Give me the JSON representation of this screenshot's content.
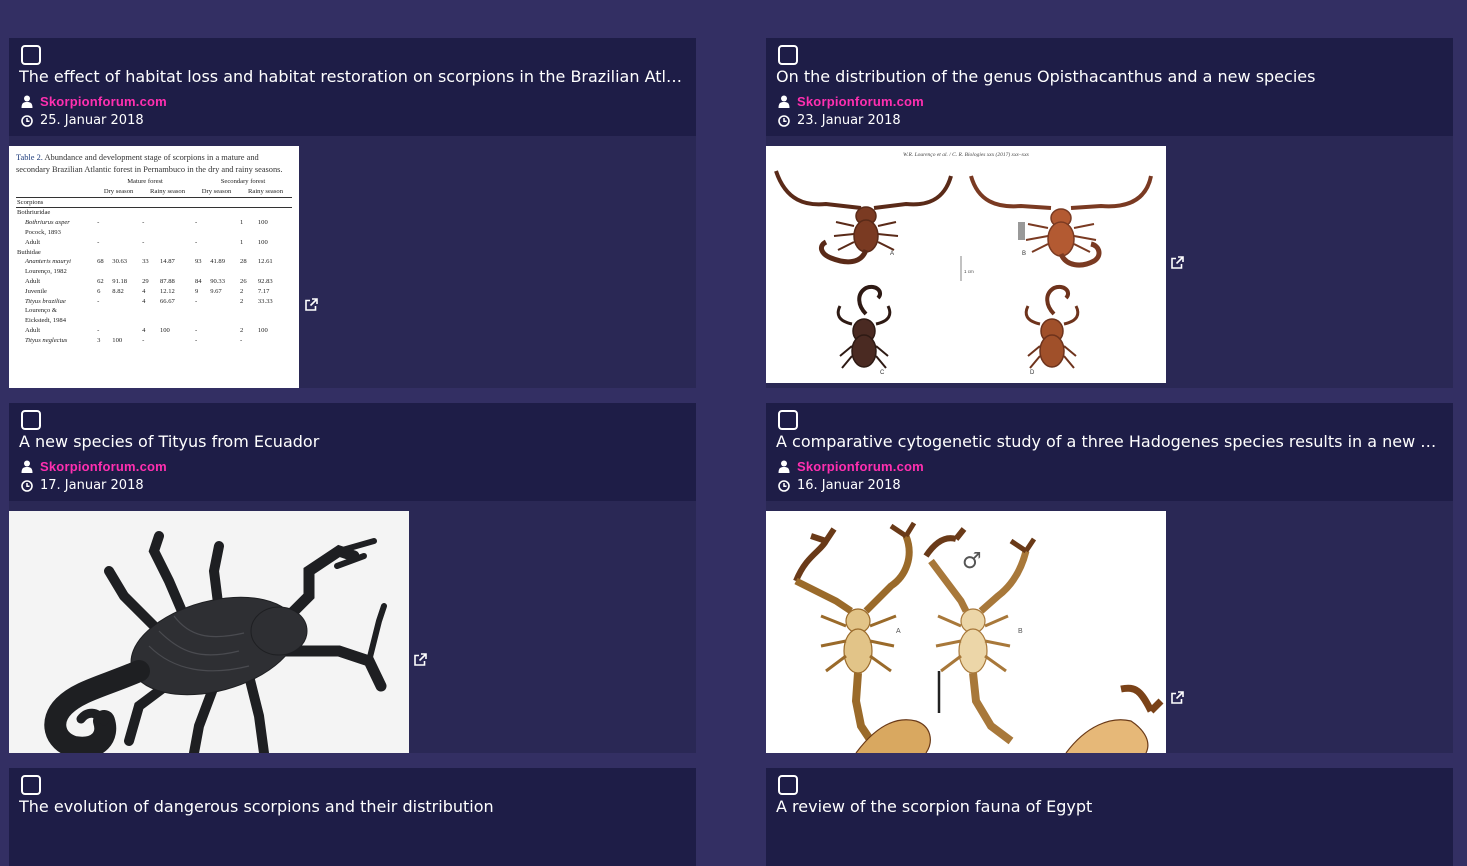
{
  "posts": [
    {
      "title": "The effect of habitat loss and habitat restoration on scorpions in the Brazilian Atl…",
      "author": "Skorpionforum.com",
      "date": "25. Januar 2018",
      "thumb": "table-figure"
    },
    {
      "title": "On the distribution of the genus Opisthacanthus and a new species",
      "author": "Skorpionforum.com",
      "date": "23. Januar 2018",
      "thumb": "scorpion-plate-figure",
      "thumb_header": "W.R. Lourenço et al. / C. R. Biologies xxx (2017) xxx–xxx"
    },
    {
      "title": "A new species of Tityus from Ecuador",
      "author": "Skorpionforum.com",
      "date": "17. Januar 2018",
      "thumb": "black-scorpion-photo"
    },
    {
      "title": "A comparative cytogenetic study of a three Hadogenes species results in a new s…",
      "author": "Skorpionforum.com",
      "date": "16. Januar 2018",
      "thumb": "hadogenes-plate-figure"
    },
    {
      "title": "The evolution of dangerous scorpions and their distribution",
      "author": "",
      "date": ""
    },
    {
      "title": "A review of the scorpion fauna of Egypt",
      "author": "",
      "date": ""
    }
  ],
  "table_figure": {
    "caption_label": "Table 2.",
    "caption": "Abundance and development stage of scorpions in a mature and secondary Brazilian Atlantic forest in Pernambuco in the dry and rainy seasons.",
    "group_headers": [
      "Mature forest",
      "Secondary forest"
    ],
    "season_headers": [
      "Dry season",
      "Rainy season",
      "Dry season",
      "Rainy season"
    ],
    "col_label": "Scorpions",
    "rows": [
      [
        "Bothriuridae",
        "",
        "",
        "",
        "",
        "",
        "",
        "",
        ""
      ],
      [
        "Bothriurus asper",
        "-",
        "",
        "-",
        "",
        "-",
        "",
        "1",
        "100"
      ],
      [
        "Pocock, 1893",
        "",
        "",
        "",
        "",
        "",
        "",
        "",
        ""
      ],
      [
        "Adult",
        "-",
        "",
        "-",
        "",
        "-",
        "",
        "1",
        "100"
      ],
      [
        "Buthidae",
        "",
        "",
        "",
        "",
        "",
        "",
        "",
        ""
      ],
      [
        "Ananteris mauryi",
        "68",
        "30.63",
        "33",
        "14.87",
        "93",
        "41.89",
        "28",
        "12.61"
      ],
      [
        "Lourenço, 1982",
        "",
        "",
        "",
        "",
        "",
        "",
        "",
        ""
      ],
      [
        "Adult",
        "62",
        "91.18",
        "29",
        "87.88",
        "84",
        "90.33",
        "26",
        "92.83"
      ],
      [
        "Juvenile",
        "6",
        "8.82",
        "4",
        "12.12",
        "9",
        "9.67",
        "2",
        "7.17"
      ],
      [
        "Tityus braziliae",
        "-",
        "",
        "4",
        "66.67",
        "-",
        "",
        "2",
        "33.33"
      ],
      [
        "Lourenço &",
        "",
        "",
        "",
        "",
        "",
        "",
        "",
        ""
      ],
      [
        "Eickstedt, 1984",
        "",
        "",
        "",
        "",
        "",
        "",
        "",
        ""
      ],
      [
        "Adult",
        "-",
        "",
        "4",
        "100",
        "-",
        "",
        "2",
        "100"
      ],
      [
        "Tityus neglectus",
        "3",
        "100",
        "-",
        "",
        "-",
        "",
        "-",
        ""
      ]
    ],
    "italic_rows": [
      1,
      5,
      9,
      13
    ]
  },
  "plate_labels": {
    "opisthacanthus": [
      "A",
      "B",
      "C",
      "D"
    ],
    "scale": "1 cm",
    "hadogenes": [
      "A",
      "B"
    ],
    "male_symbol": "♂"
  },
  "colors": {
    "page_bg": "#332f63",
    "card_bg": "#2a2855",
    "card_header_bg": "#1e1d47",
    "author_color": "#ff2fb0",
    "text": "#ffffff"
  },
  "icons": {
    "checkbox": "checkbox-icon",
    "author": "user-icon",
    "date": "clock-icon",
    "external": "external-link-icon"
  }
}
